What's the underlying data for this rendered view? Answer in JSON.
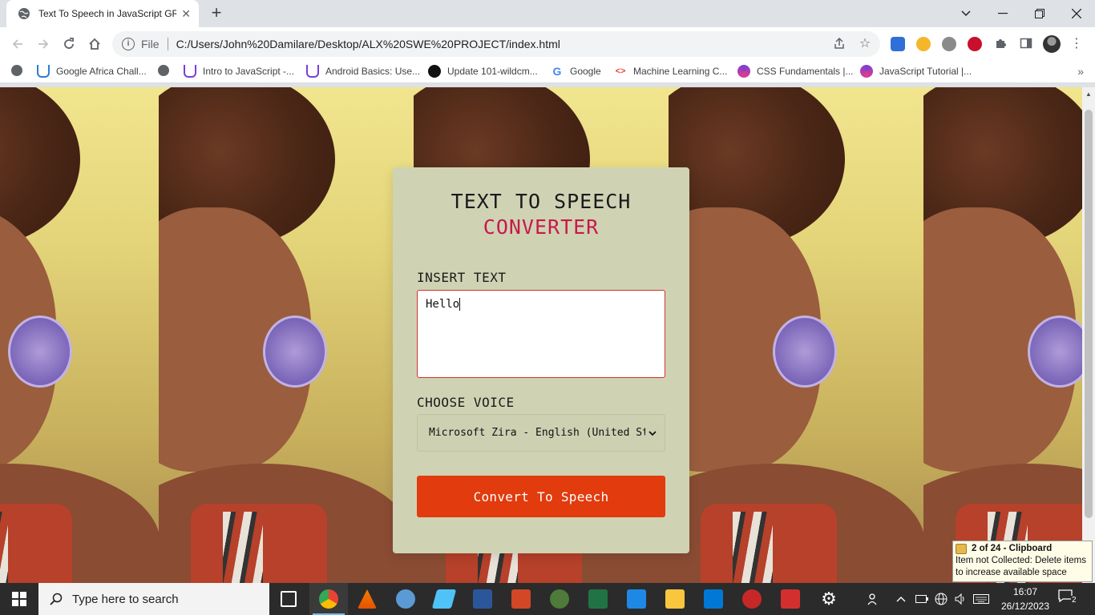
{
  "browser": {
    "tab_title": "Text To Speech in JavaScript GRO",
    "new_tab_symbol": "+",
    "omnibox": {
      "scheme": "File",
      "url": "C:/Users/John%20Damilare/Desktop/ALX%20SWE%20PROJECT/index.html"
    },
    "bookmarks": [
      {
        "label": "Google Africa Chall...",
        "icon": "udacity-icon",
        "color": "#2e7dd1"
      },
      {
        "label": "",
        "icon": "globe-icon",
        "color": "#5f6368"
      },
      {
        "label": "Intro to JavaScript -...",
        "icon": "udacity-icon",
        "color": "#7b3fd6"
      },
      {
        "label": "Android Basics: Use...",
        "icon": "udacity-icon",
        "color": "#7b3fd6"
      },
      {
        "label": "Update 101-wildcm...",
        "icon": "github-icon",
        "color": "#111111"
      },
      {
        "label": "Google",
        "icon": "google-icon",
        "color": "#4285f4"
      },
      {
        "label": "Machine Learning C...",
        "icon": "code-icon",
        "color": "#ea4335"
      },
      {
        "label": "CSS Fundamentals |...",
        "icon": "swirl-icon",
        "color": "#7b3fd6"
      },
      {
        "label": "JavaScript Tutorial |...",
        "icon": "swirl-icon",
        "color": "#7b3fd6"
      }
    ]
  },
  "app": {
    "title_line1": "TEXT TO SPEECH",
    "title_line2": "CONVERTER",
    "insert_label": "INSERT TEXT",
    "textarea_value": "Hello",
    "voice_label": "CHOOSE VOICE",
    "voice_selected": "Microsoft Zira - English (United States)",
    "convert_button": "Convert To Speech",
    "colors": {
      "accent": "#c8194a",
      "button": "#e23b0e",
      "card": "#cfd3b4"
    }
  },
  "clipboard_toast": {
    "title": "2 of 24 - Clipboard",
    "message": "Item not Collected: Delete items to increase available space"
  },
  "taskbar": {
    "search_placeholder": "Type here to search",
    "time": "16:07",
    "date": "26/12/2023",
    "notification_count": "2"
  }
}
